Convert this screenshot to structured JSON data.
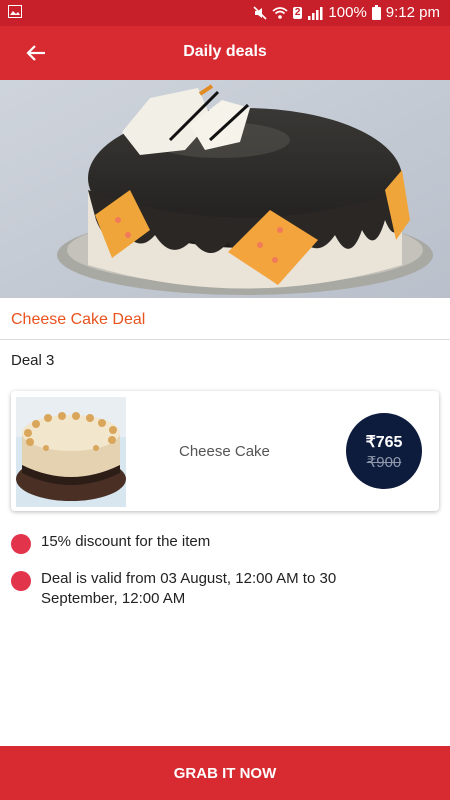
{
  "status_bar": {
    "battery": "100%",
    "time": "9:12 pm",
    "sim_badge": "2",
    "icons": [
      "image-icon",
      "mute-icon",
      "wifi-icon",
      "signal-icon",
      "battery-icon"
    ]
  },
  "app_bar": {
    "title": "Daily deals",
    "back_icon": "arrow-left-icon"
  },
  "deal": {
    "title": "Cheese Cake Deal",
    "subtitle": "Deal 3"
  },
  "item": {
    "name": "Cheese Cake",
    "price_now": "₹765",
    "price_was": "₹900"
  },
  "details": [
    {
      "icon": "red-dot-icon",
      "text": "15% discount for the item"
    },
    {
      "icon": "red-dot-icon",
      "text": "Deal is valid from 03 August, 12:00 AM to 30 September, 12:00 AM"
    }
  ],
  "cta": {
    "label": "GRAB IT NOW"
  },
  "colors": {
    "brand_red": "#d72a31",
    "status_red": "#c8202a",
    "deal_title_orange": "#e8531e",
    "price_circle_navy": "#0d1b3d",
    "bullet_red": "#e2344a"
  }
}
